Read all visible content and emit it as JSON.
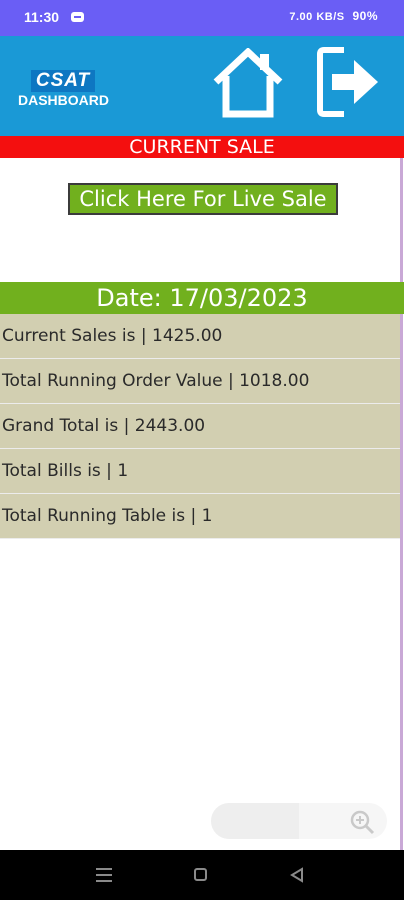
{
  "status": {
    "time": "11:30",
    "signal": "7.00 KB/S",
    "battery": "90%"
  },
  "header": {
    "logo_top": "CSAT",
    "logo_bottom": "DASHBOARD"
  },
  "page": {
    "title": "CURRENT SALE",
    "live_button": "Click Here For Live Sale",
    "date": "Date: 17/03/2023"
  },
  "stats": [
    "Current Sales is | 1425.00",
    "Total Running Order Value | 1018.00",
    "Grand Total is | 2443.00",
    "Total Bills is | 1",
    "Total Running Table is | 1"
  ],
  "colors": {
    "header": "#1a99d6",
    "title_bar": "#f40f0f",
    "accent_green": "#71b01e",
    "row_bg": "#d2cfb1"
  },
  "icons": [
    "message-icon",
    "home-icon",
    "logout-icon",
    "zoom-in-icon"
  ]
}
